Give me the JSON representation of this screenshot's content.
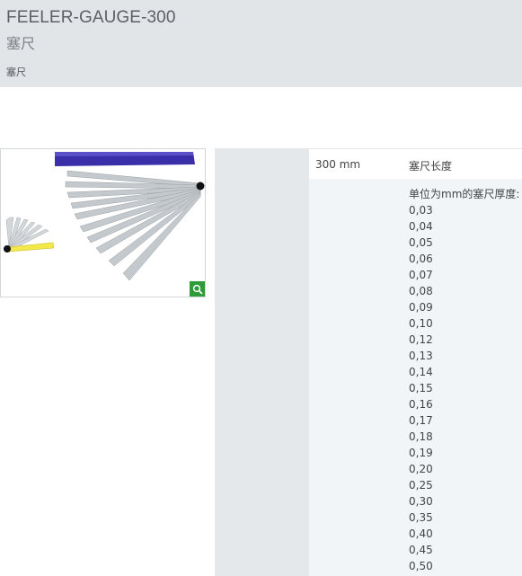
{
  "header": {
    "title": "FEELER-GAUGE-300",
    "subtitle": "塞尺",
    "breadcrumb": "塞尺"
  },
  "image": {
    "icon": "zoom-magnifier-icon",
    "zoom_color": "#2f9a3a"
  },
  "specs": {
    "length_value": "300  mm",
    "length_label": "塞尺长度",
    "thickness_label": "单位为mm的塞尺厚度:",
    "thicknesses": [
      "0,03",
      "0,04",
      "0,05",
      "0,06",
      "0,07",
      "0,08",
      "0,09",
      "0,10",
      "0,12",
      "0,13",
      "0,14",
      "0,15",
      "0,16",
      "0,17",
      "0,18",
      "0,19",
      "0,20",
      "0,25",
      "0,30",
      "0,35",
      "0,40",
      "0,45",
      "0,50"
    ]
  }
}
